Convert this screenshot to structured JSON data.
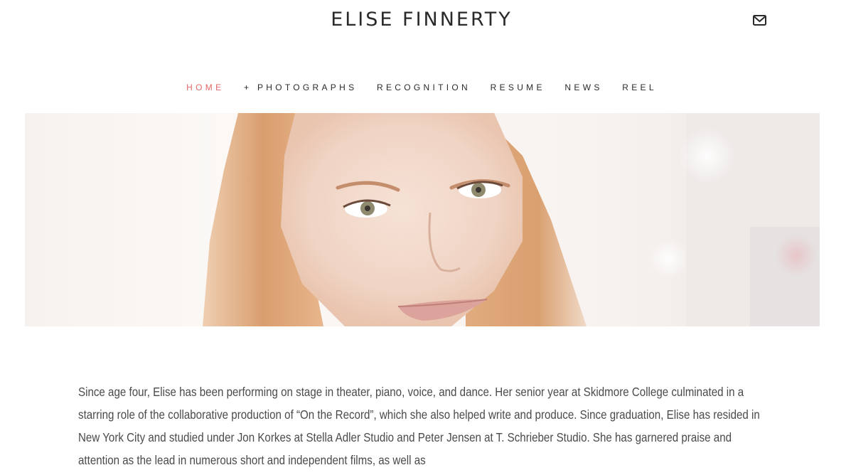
{
  "header": {
    "site_title": "ELISE FINNERTY",
    "mail_icon": "envelope-icon"
  },
  "nav": {
    "items": [
      {
        "label": "HOME",
        "active": true
      },
      {
        "label": "+ PHOTOGRAPHS",
        "active": false
      },
      {
        "label": "RECOGNITION",
        "active": false
      },
      {
        "label": "RESUME",
        "active": false
      },
      {
        "label": "NEWS",
        "active": false
      },
      {
        "label": "REEL",
        "active": false
      }
    ],
    "active_color": "#e06767"
  },
  "hero": {
    "image": "portrait-photo"
  },
  "main": {
    "bio": "Since age four, Elise has been performing on stage in theater, piano, voice, and dance. Her senior year at Skidmore College culminated in a starring role of the collaborative production of “On the Record”, which she also helped write and produce. Since graduation, Elise has resided in New York City and studied under Jon Korkes at Stella Adler Studio and Peter Jensen at T. Schrieber Studio. She has garnered praise and attention as the lead in numerous short and independent films, as well as"
  }
}
